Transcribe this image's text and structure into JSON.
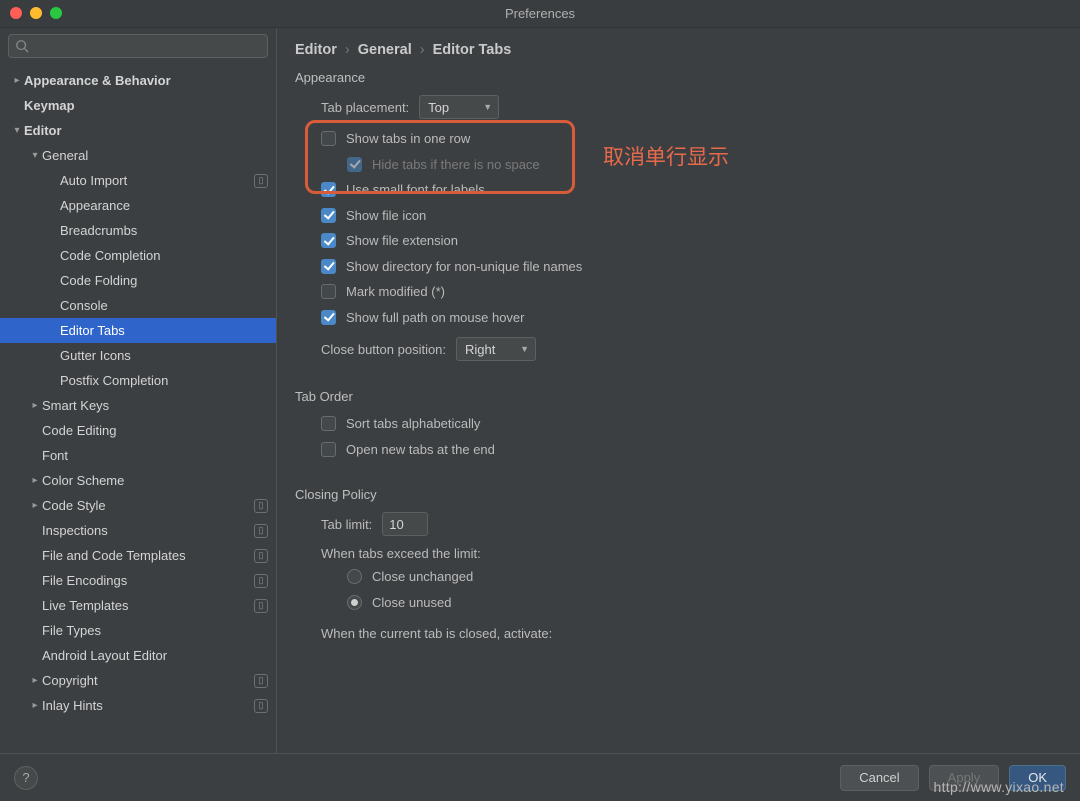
{
  "title": "Preferences",
  "watermark": "http://www.yixao.net",
  "sidebar": {
    "items": [
      {
        "label": "Appearance & Behavior",
        "depth": 0,
        "chev": ">",
        "bold": true
      },
      {
        "label": "Keymap",
        "depth": 0,
        "chev": "",
        "bold": true
      },
      {
        "label": "Editor",
        "depth": 0,
        "chev": "v",
        "bold": true
      },
      {
        "label": "General",
        "depth": 1,
        "chev": "v"
      },
      {
        "label": "Auto Import",
        "depth": 2,
        "badge": true
      },
      {
        "label": "Appearance",
        "depth": 2
      },
      {
        "label": "Breadcrumbs",
        "depth": 2
      },
      {
        "label": "Code Completion",
        "depth": 2
      },
      {
        "label": "Code Folding",
        "depth": 2
      },
      {
        "label": "Console",
        "depth": 2
      },
      {
        "label": "Editor Tabs",
        "depth": 2,
        "selected": true
      },
      {
        "label": "Gutter Icons",
        "depth": 2
      },
      {
        "label": "Postfix Completion",
        "depth": 2
      },
      {
        "label": "Smart Keys",
        "depth": 1,
        "chev": ">"
      },
      {
        "label": "Code Editing",
        "depth": 1
      },
      {
        "label": "Font",
        "depth": 1
      },
      {
        "label": "Color Scheme",
        "depth": 1,
        "chev": ">"
      },
      {
        "label": "Code Style",
        "depth": 1,
        "chev": ">",
        "badge": true
      },
      {
        "label": "Inspections",
        "depth": 1,
        "badge": true
      },
      {
        "label": "File and Code Templates",
        "depth": 1,
        "badge": true
      },
      {
        "label": "File Encodings",
        "depth": 1,
        "badge": true
      },
      {
        "label": "Live Templates",
        "depth": 1,
        "badge": true
      },
      {
        "label": "File Types",
        "depth": 1
      },
      {
        "label": "Android Layout Editor",
        "depth": 1
      },
      {
        "label": "Copyright",
        "depth": 1,
        "chev": ">",
        "badge": true
      },
      {
        "label": "Inlay Hints",
        "depth": 1,
        "chev": ">",
        "badge": true
      }
    ]
  },
  "breadcrumb": [
    "Editor",
    "General",
    "Editor Tabs"
  ],
  "appearance": {
    "section": "Appearance",
    "tab_placement_label": "Tab placement:",
    "tab_placement_value": "Top",
    "show_one_row": {
      "label": "Show tabs in one row",
      "checked": false
    },
    "hide_no_space": {
      "label": "Hide tabs if there is no space",
      "checked": true,
      "disabled": true
    },
    "small_font": {
      "label": "Use small font for labels",
      "checked": true
    },
    "show_icon": {
      "label": "Show file icon",
      "checked": true
    },
    "show_ext": {
      "label": "Show file extension",
      "checked": true
    },
    "show_dir": {
      "label": "Show directory for non-unique file names",
      "checked": true
    },
    "mark_mod": {
      "label": "Mark modified (*)",
      "checked": false
    },
    "show_path": {
      "label": "Show full path on mouse hover",
      "checked": true
    },
    "close_btn_label": "Close button position:",
    "close_btn_value": "Right"
  },
  "tab_order": {
    "section": "Tab Order",
    "sort_alpha": {
      "label": "Sort tabs alphabetically",
      "checked": false
    },
    "open_end": {
      "label": "Open new tabs at the end",
      "checked": false
    }
  },
  "closing": {
    "section": "Closing Policy",
    "tab_limit_label": "Tab limit:",
    "tab_limit_value": "10",
    "exceed_label": "When tabs exceed the limit:",
    "close_unchanged": {
      "label": "Close unchanged",
      "checked": false
    },
    "close_unused": {
      "label": "Close unused",
      "checked": true
    },
    "closed_activate_label": "When the current tab is closed, activate:"
  },
  "annotation": "取消单行显示",
  "footer": {
    "cancel": "Cancel",
    "apply": "Apply",
    "ok": "OK"
  }
}
